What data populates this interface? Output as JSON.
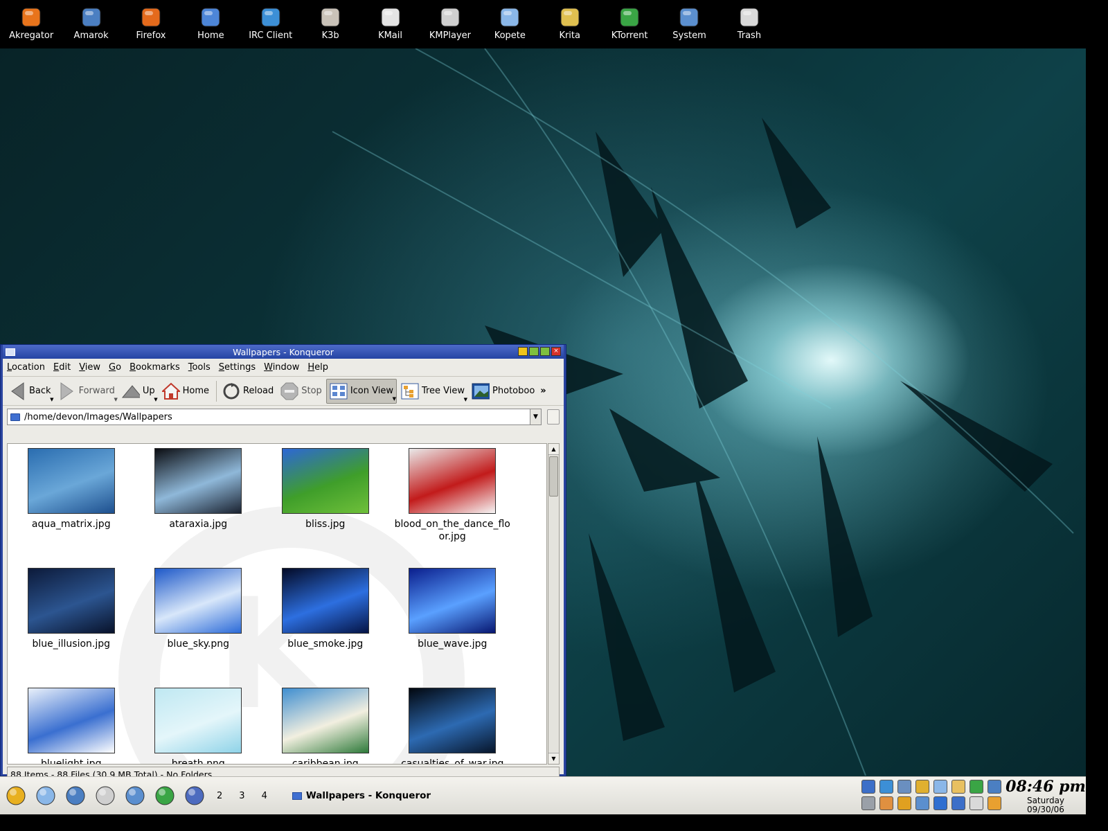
{
  "launchers": [
    {
      "label": "Akregator",
      "icon": "rss-icon",
      "color": "#e8741c"
    },
    {
      "label": "Amarok",
      "icon": "amarok-icon",
      "color": "#4b7fc2"
    },
    {
      "label": "Firefox",
      "icon": "firefox-icon",
      "color": "#e46a1c"
    },
    {
      "label": "Home",
      "icon": "home-folder-icon",
      "color": "#4d86d8"
    },
    {
      "label": "IRC Client",
      "icon": "irc-icon",
      "color": "#3c8fd6"
    },
    {
      "label": "K3b",
      "icon": "k3b-icon",
      "color": "#c9c2b8"
    },
    {
      "label": "KMail",
      "icon": "kmail-icon",
      "color": "#e4e4e4"
    },
    {
      "label": "KMPlayer",
      "icon": "kmplayer-icon",
      "color": "#cfcfcf"
    },
    {
      "label": "Kopete",
      "icon": "kopete-icon",
      "color": "#8ab7e8"
    },
    {
      "label": "Krita",
      "icon": "krita-icon",
      "color": "#e0c050"
    },
    {
      "label": "KTorrent",
      "icon": "ktorrent-icon",
      "color": "#3aa545"
    },
    {
      "label": "System",
      "icon": "system-monitor-icon",
      "color": "#5b8fcf"
    },
    {
      "label": "Trash",
      "icon": "trash-icon",
      "color": "#d9d9d9"
    }
  ],
  "window": {
    "title": "Wallpapers - Konqueror",
    "menu": [
      {
        "label": "Location",
        "accel": "L",
        "rest": "ocation"
      },
      {
        "label": "Edit",
        "accel": "E",
        "rest": "dit"
      },
      {
        "label": "View",
        "accel": "V",
        "rest": "iew"
      },
      {
        "label": "Go",
        "accel": "G",
        "rest": "o"
      },
      {
        "label": "Bookmarks",
        "accel": "B",
        "rest": "ookmarks"
      },
      {
        "label": "Tools",
        "accel": "T",
        "rest": "ools"
      },
      {
        "label": "Settings",
        "accel": "S",
        "rest": "ettings"
      },
      {
        "label": "Window",
        "accel": "W",
        "rest": "indow"
      },
      {
        "label": "Help",
        "accel": "H",
        "rest": "elp"
      }
    ],
    "toolbar": {
      "back": "Back",
      "forward": "Forward",
      "up": "Up",
      "home": "Home",
      "reload": "Reload",
      "stop": "Stop",
      "icon_view": "Icon View",
      "tree_view": "Tree View",
      "photobook": "Photoboo",
      "more": "»"
    },
    "location": "/home/devon/Images/Wallpapers",
    "files": [
      {
        "name": "aqua_matrix.jpg",
        "colors": [
          "#2a6db0",
          "#6aa7d8",
          "#1d4f8e"
        ]
      },
      {
        "name": "ataraxia.jpg",
        "colors": [
          "#0b0d12",
          "#8fb8d9",
          "#1a2230"
        ]
      },
      {
        "name": "bliss.jpg",
        "colors": [
          "#2d67d6",
          "#3f9e2a",
          "#6fc03a"
        ]
      },
      {
        "name": "blood_on_the_dance_floor.jpg",
        "colors": [
          "#e9e9e9",
          "#c21b1b",
          "#f6f6f6"
        ]
      },
      {
        "name": "blue_illusion.jpg",
        "colors": [
          "#0c1a3a",
          "#2c5590",
          "#08122a"
        ]
      },
      {
        "name": "blue_sky.png",
        "colors": [
          "#1d58c8",
          "#d8e7fa",
          "#2b6ad8"
        ]
      },
      {
        "name": "blue_smoke.jpg",
        "colors": [
          "#030a26",
          "#2d6fe0",
          "#051445"
        ]
      },
      {
        "name": "blue_wave.jpg",
        "colors": [
          "#0a1e8c",
          "#5aa0ff",
          "#071670"
        ]
      },
      {
        "name": "bluelight.jpg",
        "colors": [
          "#e9f0fa",
          "#3a6fd0",
          "#ffffff"
        ]
      },
      {
        "name": "breath.png",
        "colors": [
          "#bfe8f2",
          "#e4f6fa",
          "#8fd3e8"
        ]
      },
      {
        "name": "caribbean.jpg",
        "colors": [
          "#3f8ed0",
          "#f2efe0",
          "#2e7a3a"
        ]
      },
      {
        "name": "casualties_of_war.jpg",
        "colors": [
          "#02070f",
          "#2d6ab2",
          "#07152a"
        ]
      }
    ],
    "status": "88 Items - 88 Files (30.9 MB Total) - No Folders"
  },
  "panel": {
    "icons": [
      {
        "name": "kmenu-icon",
        "color": "#e8b020"
      },
      {
        "name": "kopete-panel-icon",
        "color": "#8ab7e8"
      },
      {
        "name": "amarok-panel-icon",
        "color": "#4b7fc2"
      },
      {
        "name": "kmplayer-panel-icon",
        "color": "#cfcfcf"
      },
      {
        "name": "kcontrol-icon",
        "color": "#5b8fcf"
      },
      {
        "name": "ktorrent-panel-icon",
        "color": "#3aa545"
      },
      {
        "name": "show-desktop-icon",
        "color": "#4d6bbf"
      }
    ],
    "desktops": [
      "2",
      "3",
      "4"
    ],
    "task": "Wallpapers - Konqueror",
    "tray": [
      {
        "name": "monitor-tray-icon",
        "color": "#3c6fc8"
      },
      {
        "name": "kopete-tray-icon",
        "color": "#3c8fd6"
      },
      {
        "name": "volume-tray-icon",
        "color": "#6a8fc0"
      },
      {
        "name": "klipper-tray-icon",
        "color": "#e0b030"
      },
      {
        "name": "chat-tray-icon",
        "color": "#8ab7e8"
      },
      {
        "name": "korganizer-tray-icon",
        "color": "#e8c060"
      },
      {
        "name": "ktorrent-tray-icon",
        "color": "#3aa545"
      },
      {
        "name": "amarok-tray-icon",
        "color": "#4b7fc2"
      },
      {
        "name": "search-tray-icon",
        "color": "#9aa0a8"
      },
      {
        "name": "keyboard-tray-icon",
        "color": "#e09040"
      },
      {
        "name": "lock-tray-icon",
        "color": "#e0a020"
      },
      {
        "name": "network-tray-icon",
        "color": "#5b8fcf"
      },
      {
        "name": "download-tray-icon",
        "color": "#2f6fd0"
      },
      {
        "name": "update-tray-icon",
        "color": "#3c6fc8"
      },
      {
        "name": "mail-tray-icon",
        "color": "#d9d9d9"
      },
      {
        "name": "notes-tray-icon",
        "color": "#e8a030"
      }
    ],
    "clock": {
      "time": "08:46 pm",
      "day": "Saturday",
      "date": "09/30/06"
    }
  }
}
